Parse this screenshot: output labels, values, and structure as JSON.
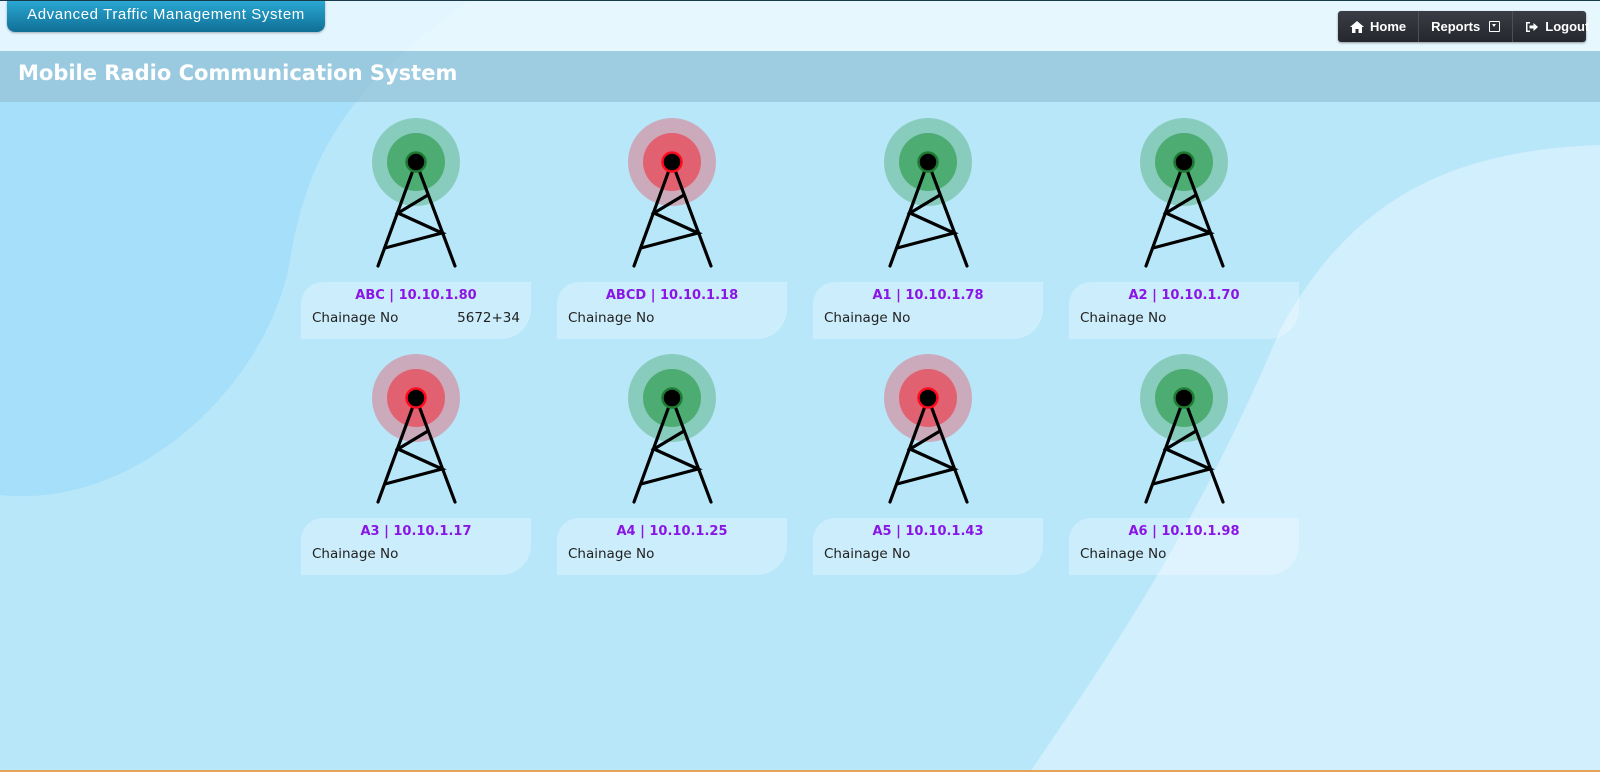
{
  "header": {
    "app_title": "Advanced Traffic Management System",
    "nav": {
      "home_label": "Home",
      "reports_label": "Reports",
      "logout_label": "Logout"
    }
  },
  "page": {
    "title": "Mobile Radio Communication System"
  },
  "colors": {
    "online": "#2e9b4a",
    "offline": "#ee3a47",
    "name_text": "#8a16e6"
  },
  "radios": [
    {
      "name": "ABC | 10.10.1.80",
      "chainage_label": "Chainage No",
      "chainage_value": "5672+34",
      "status": "online"
    },
    {
      "name": "ABCD | 10.10.1.18",
      "chainage_label": "Chainage No",
      "chainage_value": "",
      "status": "offline"
    },
    {
      "name": "A1 | 10.10.1.78",
      "chainage_label": "Chainage No",
      "chainage_value": "",
      "status": "online"
    },
    {
      "name": "A2 | 10.10.1.70",
      "chainage_label": "Chainage No",
      "chainage_value": "",
      "status": "online"
    },
    {
      "name": "A3 | 10.10.1.17",
      "chainage_label": "Chainage No",
      "chainage_value": "",
      "status": "offline"
    },
    {
      "name": "A4 | 10.10.1.25",
      "chainage_label": "Chainage No",
      "chainage_value": "",
      "status": "online"
    },
    {
      "name": "A5 | 10.10.1.43",
      "chainage_label": "Chainage No",
      "chainage_value": "",
      "status": "offline"
    },
    {
      "name": "A6 | 10.10.1.98",
      "chainage_label": "Chainage No",
      "chainage_value": "",
      "status": "online"
    }
  ]
}
